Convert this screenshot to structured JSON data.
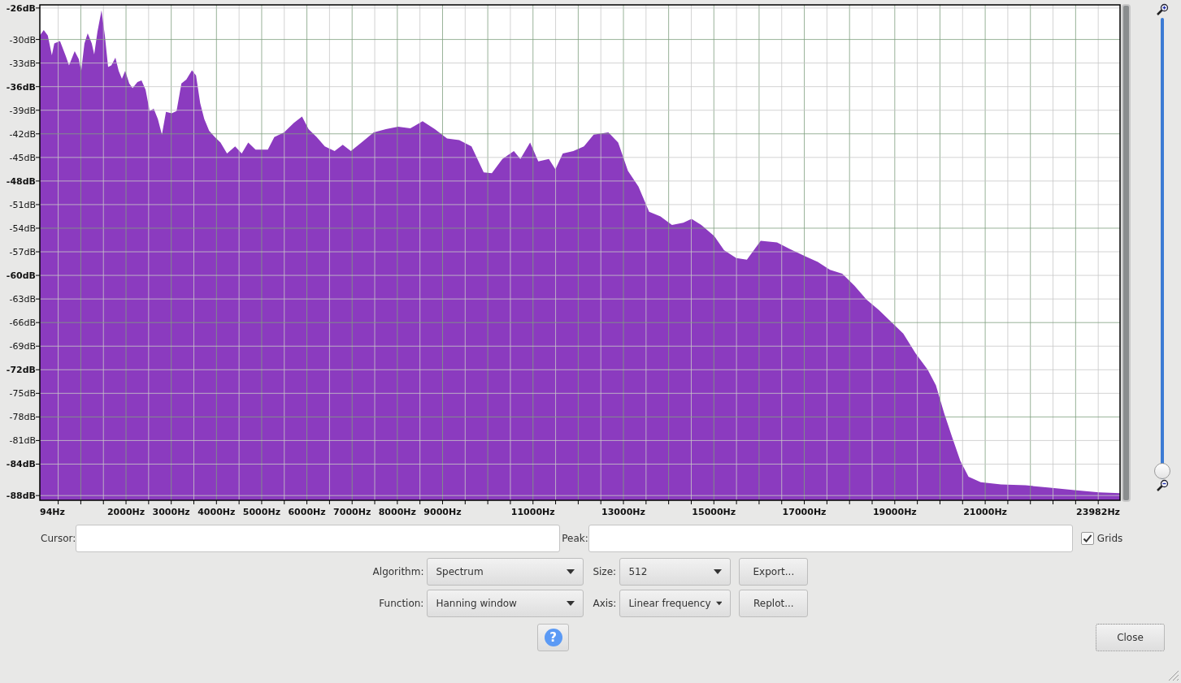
{
  "spectrum": {
    "chart_data": {
      "type": "area",
      "grid": true,
      "xlim": [
        94,
        23982
      ],
      "ylim": [
        -88.6,
        -25.6
      ],
      "yticks": [
        {
          "value": -26,
          "label": "-26dB"
        },
        {
          "value": -30,
          "label": "-30dB"
        },
        {
          "value": -33,
          "label": "-33dB"
        },
        {
          "value": -36,
          "label": "-36dB"
        },
        {
          "value": -39,
          "label": "-39dB"
        },
        {
          "value": -42,
          "label": "-42dB"
        },
        {
          "value": -45,
          "label": "-45dB"
        },
        {
          "value": -48,
          "label": "-48dB"
        },
        {
          "value": -51,
          "label": "-51dB"
        },
        {
          "value": -54,
          "label": "-54dB"
        },
        {
          "value": -57,
          "label": "-57dB"
        },
        {
          "value": -60,
          "label": "-60dB"
        },
        {
          "value": -63,
          "label": "-63dB"
        },
        {
          "value": -66,
          "label": "-66dB"
        },
        {
          "value": -69,
          "label": "-69dB"
        },
        {
          "value": -72,
          "label": "-72dB"
        },
        {
          "value": -75,
          "label": "-75dB"
        },
        {
          "value": -78,
          "label": "-78dB"
        },
        {
          "value": -81,
          "label": "-81dB"
        },
        {
          "value": -84,
          "label": "-84dB"
        },
        {
          "value": -88,
          "label": "-88dB"
        }
      ],
      "xticks": [
        {
          "value": 94,
          "label": "94Hz"
        },
        {
          "value": 2000,
          "label": "2000Hz"
        },
        {
          "value": 3000,
          "label": "3000Hz"
        },
        {
          "value": 4000,
          "label": "4000Hz"
        },
        {
          "value": 5000,
          "label": "5000Hz"
        },
        {
          "value": 6000,
          "label": "6000Hz"
        },
        {
          "value": 7000,
          "label": "7000Hz"
        },
        {
          "value": 8000,
          "label": "8000Hz"
        },
        {
          "value": 9000,
          "label": "9000Hz"
        },
        {
          "value": 11000,
          "label": "11000Hz"
        },
        {
          "value": 13000,
          "label": "13000Hz"
        },
        {
          "value": 15000,
          "label": "15000Hz"
        },
        {
          "value": 17000,
          "label": "17000Hz"
        },
        {
          "value": 19000,
          "label": "19000Hz"
        },
        {
          "value": 21000,
          "label": "21000Hz"
        },
        {
          "value": 23982,
          "label": "23982Hz"
        }
      ],
      "x": [
        94,
        180,
        270,
        360,
        414,
        540,
        667,
        739,
        865,
        955,
        1009,
        1081,
        1153,
        1243,
        1297,
        1369,
        1459,
        1532,
        1604,
        1676,
        1766,
        1838,
        1910,
        1982,
        2072,
        2144,
        2252,
        2342,
        2432,
        2522,
        2612,
        2703,
        2793,
        2883,
        3009,
        3117,
        3225,
        3333,
        3459,
        3549,
        3640,
        3730,
        3838,
        3964,
        4090,
        4234,
        4414,
        4559,
        4703,
        4865,
        5135,
        5279,
        5496,
        5712,
        5892,
        6036,
        6216,
        6396,
        6613,
        6793,
        6973,
        7207,
        7477,
        7748,
        8018,
        8288,
        8559,
        8829,
        9099,
        9369,
        9640,
        9910,
        10090,
        10324,
        10577,
        10721,
        10937,
        11117,
        11351,
        11495,
        11658,
        11892,
        12126,
        12342,
        12667,
        12883,
        13099,
        13333,
        13568,
        13820,
        14072,
        14324,
        14505,
        14721,
        15009,
        15225,
        15495,
        15730,
        16036,
        16396,
        16667,
        17027,
        17297,
        17568,
        17838,
        18108,
        18378,
        18649,
        18919,
        19189,
        19459,
        19730,
        19910,
        20090,
        20270,
        20450,
        20631,
        20901,
        21351,
        21892,
        22432,
        22973,
        23514,
        23982
      ],
      "series": [
        {
          "color": "#8b3bbf",
          "values": [
            -29.5,
            -28.8,
            -29.5,
            -32,
            -30.5,
            -30.2,
            -32.1,
            -33.3,
            -31.5,
            -32.5,
            -34,
            -30.5,
            -29.2,
            -30.5,
            -31.9,
            -29,
            -26.3,
            -29.5,
            -33.5,
            -33.3,
            -32.3,
            -34,
            -35,
            -34,
            -35.6,
            -36.2,
            -35.4,
            -35.2,
            -36.4,
            -39.1,
            -38.8,
            -40.1,
            -42.1,
            -39.2,
            -39.4,
            -39.1,
            -35.6,
            -35.1,
            -33.9,
            -34.6,
            -38.1,
            -40.1,
            -41.6,
            -42.4,
            -43.1,
            -44.5,
            -43.6,
            -44.5,
            -43.1,
            -44,
            -44,
            -42.4,
            -41.8,
            -40.6,
            -39.8,
            -41.4,
            -42.4,
            -43.6,
            -44.2,
            -43.4,
            -44.2,
            -43.1,
            -41.8,
            -41.4,
            -41.1,
            -41.3,
            -40.4,
            -41.4,
            -42.6,
            -42.8,
            -43.6,
            -46.9,
            -47,
            -45.2,
            -44.2,
            -45.2,
            -43.1,
            -45.5,
            -45.2,
            -46.5,
            -44.5,
            -44.2,
            -43.6,
            -42.1,
            -41.8,
            -43.1,
            -46.7,
            -48.7,
            -51.9,
            -52.5,
            -53.6,
            -53.3,
            -52.8,
            -53.6,
            -55,
            -56.8,
            -57.8,
            -58,
            -55.6,
            -55.8,
            -56.6,
            -57.6,
            -58.3,
            -59.3,
            -59.8,
            -61.3,
            -63.1,
            -64.4,
            -65.9,
            -67.4,
            -69.9,
            -72,
            -74,
            -77.5,
            -80.6,
            -83.6,
            -85.6,
            -86.3,
            -86.6,
            -86.7,
            -87,
            -87.3,
            -87.6,
            -87.7
          ]
        }
      ]
    }
  },
  "zoom_slider": {
    "level": 0
  },
  "cursor": {
    "label": "Cursor:"
  },
  "peak": {
    "label": "Peak:"
  },
  "grids": {
    "label": "Grids",
    "checked": true
  },
  "algorithm": {
    "label": "Algorithm:",
    "value": "Spectrum"
  },
  "size": {
    "label": "Size:",
    "value": "512"
  },
  "export_button": "Export...",
  "function": {
    "label": "Function:",
    "value": "Hanning window"
  },
  "axis": {
    "label": "Axis:",
    "value": "Linear frequency"
  },
  "replot_button": "Replot...",
  "help_button": "?",
  "close_button": "Close"
}
